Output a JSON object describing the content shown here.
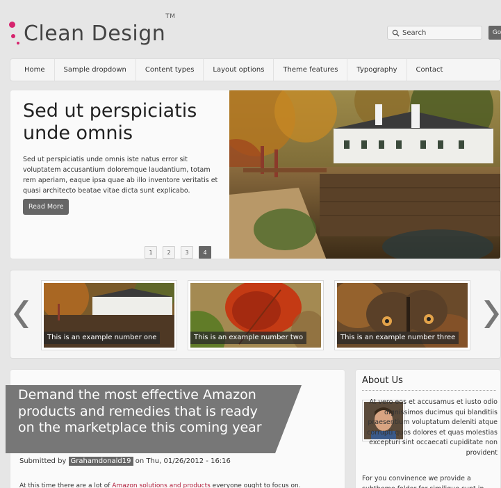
{
  "header": {
    "logo_text": "Clean Design",
    "logo_tm": "TM",
    "search_placeholder": "Search",
    "go_label": "Go"
  },
  "nav": {
    "items": [
      "Home",
      "Sample dropdown",
      "Content types",
      "Layout options",
      "Theme features",
      "Typography",
      "Contact"
    ]
  },
  "slider": {
    "title": "Sed ut perspiciatis unde omnis",
    "body": "Sed ut perspiciatis unde omnis iste natus error sit voluptatem accusantium doloremque laudantium, totam rem aperiam, eaque ipsa quae ab illo inventore veritatis et quasi architecto beatae vitae dicta sunt explicabo.",
    "read_more": "Read More",
    "pages": [
      "1",
      "2",
      "3",
      "4"
    ],
    "active_page": "4"
  },
  "carousel": {
    "items": [
      {
        "caption": "This is an example number one"
      },
      {
        "caption": "This is an example number two"
      },
      {
        "caption": "This is an example number three"
      }
    ]
  },
  "article": {
    "title": "Demand the most effective Amazon products and remedies that is ready on the marketplace this coming year",
    "submitted_by": "Submitted by",
    "author": "Grahamdonald19",
    "date": "on Thu, 01/26/2012 - 16:16",
    "text_before": "At this time there are a lot of ",
    "link_text": "Amazon solutions and products",
    "text_after": " everyone ought to focus on."
  },
  "sidebar": {
    "title": "About Us",
    "text1": "At vero eos et accusamus et iusto odio dignissimos ducimus qui blanditiis praesentium voluptatum deleniti atque corrupti quos dolores et quas molestias excepturi sint occaecati cupiditate non provident",
    "text2": "For you convinence we provide a subtheme folder for  similique sunt in culpa qui officia"
  },
  "colors": {
    "accent": "#d6246e",
    "link": "#b21e3c",
    "banner": "#777777"
  }
}
